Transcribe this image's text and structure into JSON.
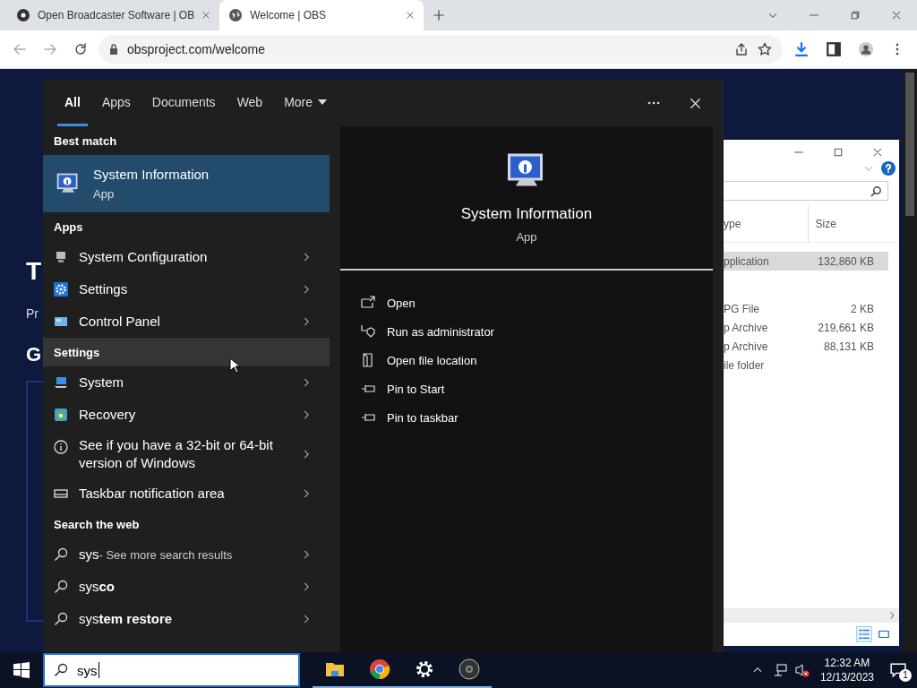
{
  "browser": {
    "tabs": [
      {
        "title": "Open Broadcaster Software | OB",
        "selected": false
      },
      {
        "title": "Welcome | OBS",
        "selected": true
      }
    ],
    "address": "obsproject.com/welcome",
    "page_fragments": [
      {
        "text": "T",
        "kind": "heading"
      },
      {
        "text": "Pr",
        "kind": "body"
      },
      {
        "text": "G",
        "kind": "subheading"
      }
    ]
  },
  "explorer": {
    "columns": [
      "ype",
      "Size"
    ],
    "rows": [
      {
        "type": "pplication",
        "size": "132,860 KB",
        "selected": true
      },
      {
        "type": "PG File",
        "size": "2 KB",
        "selected": false
      },
      {
        "type": "p Archive",
        "size": "219,661 KB",
        "selected": false
      },
      {
        "type": "p Archive",
        "size": "88,131 KB",
        "selected": false
      },
      {
        "type": "ile folder",
        "size": "",
        "selected": false
      }
    ]
  },
  "search": {
    "tabs": [
      {
        "label": "All",
        "selected": true
      },
      {
        "label": "Apps",
        "selected": false
      },
      {
        "label": "Documents",
        "selected": false
      },
      {
        "label": "Web",
        "selected": false
      },
      {
        "label": "More",
        "selected": false
      }
    ],
    "best_match": {
      "heading": "Best match",
      "title": "System Information",
      "subtitle": "App",
      "selected": true
    },
    "sections": [
      {
        "heading": "Apps",
        "highlighted": false,
        "items": [
          {
            "label": "System Configuration"
          },
          {
            "label": "Settings"
          },
          {
            "label": "Control Panel"
          }
        ]
      },
      {
        "heading": "Settings",
        "highlighted": true,
        "items": [
          {
            "label": "System"
          },
          {
            "label": "Recovery"
          },
          {
            "label": "See if you have a 32-bit or 64-bit version of Windows"
          },
          {
            "label": "Taskbar notification area"
          }
        ]
      },
      {
        "heading": "Search the web",
        "highlighted": false,
        "items": [
          {
            "label": "sys",
            "note": "- See more search results"
          },
          {
            "label": "sys**co**"
          },
          {
            "label": "sys**tem restore**"
          }
        ]
      }
    ],
    "details": {
      "title": "System Information",
      "subtitle": "App",
      "actions": [
        "Open",
        "Run as administrator",
        "Open file location",
        "Pin to Start",
        "Pin to taskbar"
      ]
    },
    "query": "sys"
  },
  "taskbar": {
    "time": "12:32 AM",
    "date": "12/13/2023",
    "notifications": "1"
  }
}
